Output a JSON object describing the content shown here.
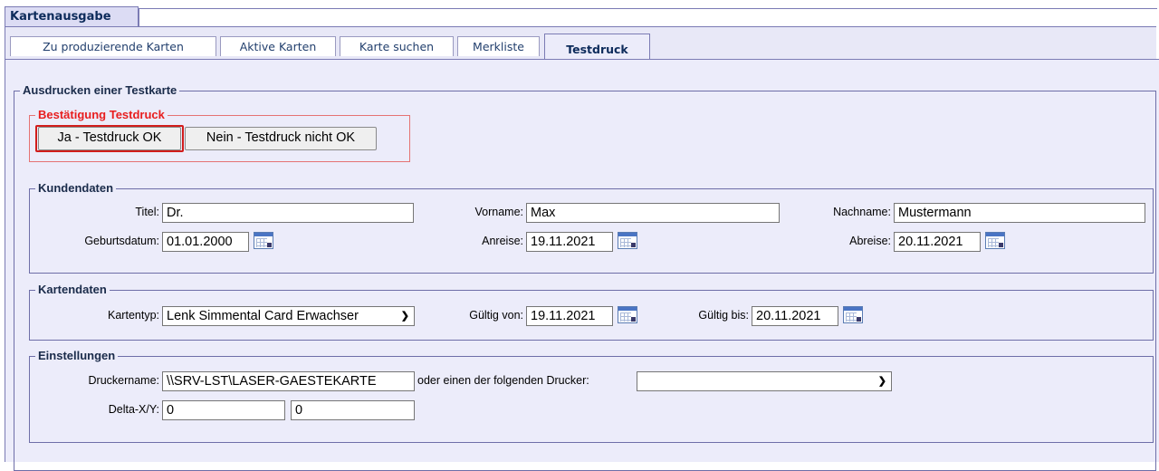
{
  "window": {
    "title": "Kartenausgabe"
  },
  "tabs": [
    {
      "label": "Zu produzierende Karten"
    },
    {
      "label": "Aktive Karten"
    },
    {
      "label": "Karte suchen"
    },
    {
      "label": "Merkliste"
    },
    {
      "label": "Testdruck",
      "active": true
    }
  ],
  "main": {
    "legend": "Ausdrucken einer Testkarte"
  },
  "confirm": {
    "legend": "Bestätigung Testdruck",
    "yes_label": "Ja - Testdruck OK",
    "no_label": "Nein - Testdruck nicht OK"
  },
  "kundendaten": {
    "legend": "Kundendaten",
    "titel_label": "Titel:",
    "titel_value": "Dr.",
    "vorname_label": "Vorname:",
    "vorname_value": "Max",
    "nachname_label": "Nachname:",
    "nachname_value": "Mustermann",
    "geburtsdatum_label": "Geburtsdatum:",
    "geburtsdatum_value": "01.01.2000",
    "anreise_label": "Anreise:",
    "anreise_value": "19.11.2021",
    "abreise_label": "Abreise:",
    "abreise_value": "20.11.2021"
  },
  "kartendaten": {
    "legend": "Kartendaten",
    "kartentyp_label": "Kartentyp:",
    "kartentyp_value": "Lenk Simmental Card Erwachser",
    "gueltig_von_label": "Gültig von:",
    "gueltig_von_value": "19.11.2021",
    "gueltig_bis_label": "Gültig bis:",
    "gueltig_bis_value": "20.11.2021"
  },
  "einstellungen": {
    "legend": "Einstellungen",
    "druckername_label": "Druckername:",
    "druckername_value": "\\\\SRV-LST\\LASER-GAESTEKARTE",
    "drucker_list_label": "oder einen der folgenden Drucker:",
    "drucker_list_value": "",
    "delta_label": "Delta-X/Y:",
    "delta_x_value": "0",
    "delta_y_value": "0"
  },
  "icons": {
    "calendar": "calendar-icon",
    "dropdown": "chevron-down-icon"
  },
  "colors": {
    "highlight": "#d11c1c",
    "confirm_legend": "#e81e1e",
    "panel_bg": "#ececfa"
  }
}
